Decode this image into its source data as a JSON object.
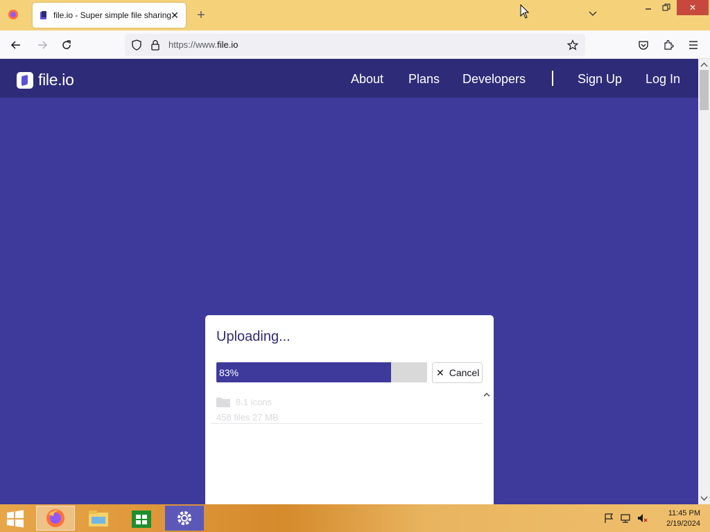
{
  "browser": {
    "tab_title": "file.io - Super simple file sharing",
    "url_prefix": "https://www.",
    "url_domain": "file.io"
  },
  "site": {
    "logo_text": "file.io",
    "nav": {
      "about": "About",
      "plans": "Plans",
      "developers": "Developers",
      "signup": "Sign Up",
      "login": "Log In"
    }
  },
  "upload": {
    "title": "Uploading...",
    "progress_percent": 83,
    "progress_label": "83%",
    "cancel_label": "Cancel",
    "file": {
      "name": "8.1 icons",
      "meta": "458 files 27 MB",
      "icon": "folder-icon"
    }
  },
  "taskbar": {
    "apps": [
      "firefox",
      "file-explorer",
      "store",
      "settings"
    ],
    "time": "11:45 PM",
    "date": "2/19/2024"
  },
  "colors": {
    "brand": "#3d3a9c",
    "header": "#2e2b78",
    "tabstrip": "#f5d27a"
  }
}
